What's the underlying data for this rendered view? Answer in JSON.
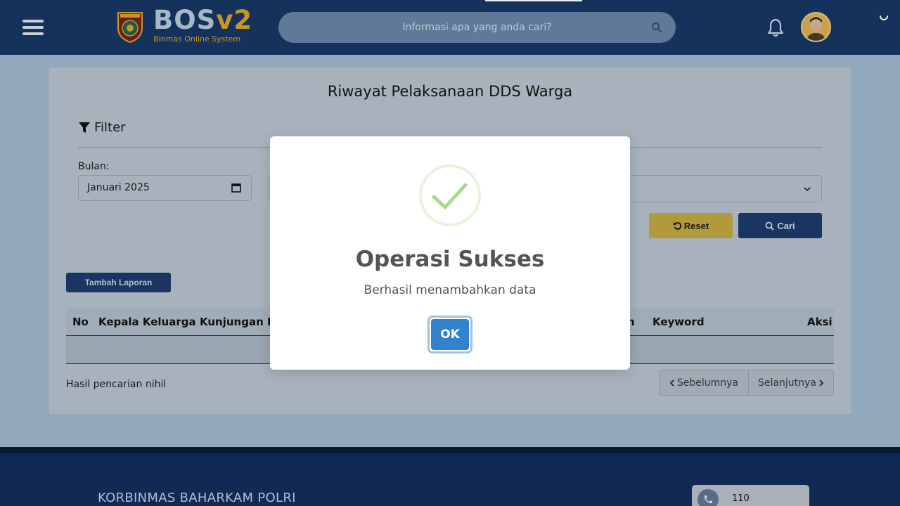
{
  "header": {
    "logo_main": "BOS",
    "logo_version": "v2",
    "logo_subtitle": "Binmas Online System",
    "search_placeholder": "Informasi apa yang anda cari?"
  },
  "page": {
    "title": "Riwayat Pelaksanaan DDS Warga",
    "filter_label": "Filter",
    "bulan_label": "Bulan:",
    "bulan_value": "Januari 2025",
    "second_label": "",
    "reset_label": "Reset",
    "cari_label": "Cari",
    "add_button_label": "Tambah Laporan"
  },
  "table": {
    "headers": [
      "No",
      "Kepala Keluarga",
      "Kunjungan Ke",
      "n",
      "Keyword",
      "Aksi"
    ],
    "empty_text": "Hasil pencarian nihil"
  },
  "pagination": {
    "prev_label": "Sebelumnya",
    "next_label": "Selanjutnya"
  },
  "footer": {
    "title": "KORBINMAS BAHARKAM POLRI",
    "contact_number": "110"
  },
  "dialog": {
    "title": "Operasi Sukses",
    "message": "Berhasil menambahkan data",
    "ok_label": "OK"
  },
  "colors": {
    "header_bg": "#15325c",
    "accent_gold": "#c79624",
    "button_blue": "#3181cc",
    "success_green": "#a5dc86"
  }
}
